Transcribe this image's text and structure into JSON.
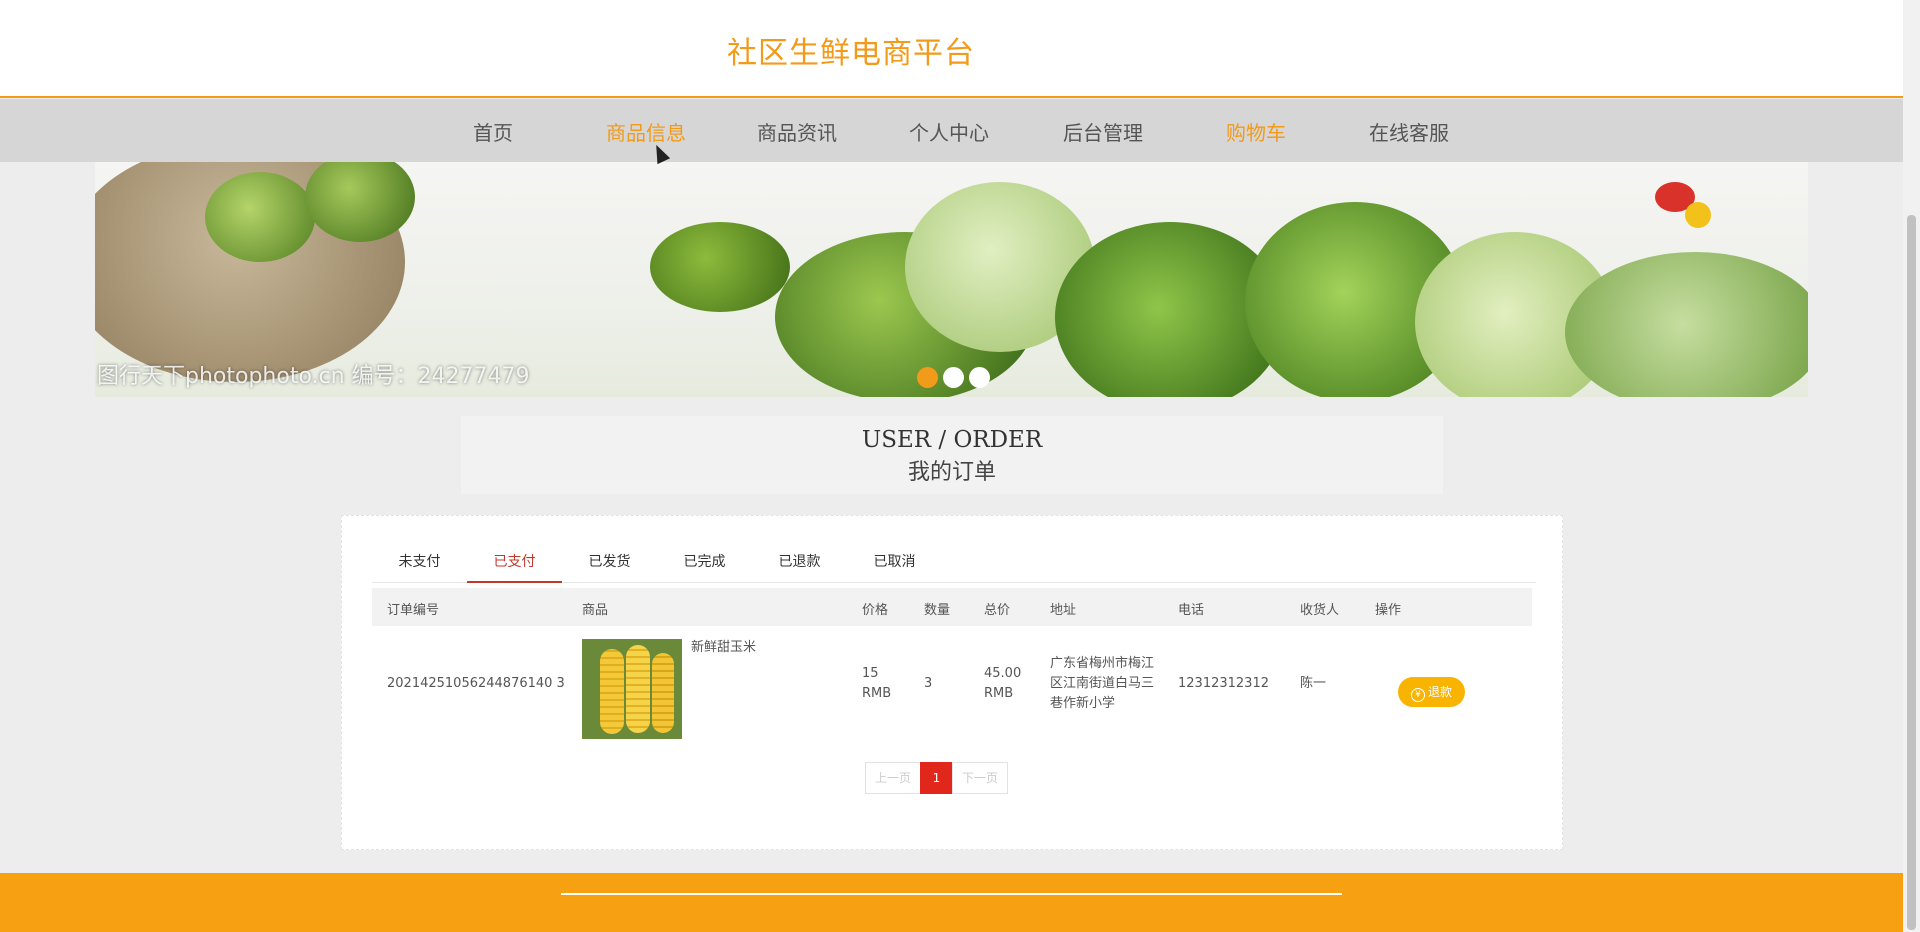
{
  "header": {
    "site_title": "社区生鲜电商平台"
  },
  "nav": {
    "items": [
      {
        "label": "首页"
      },
      {
        "label": "商品信息"
      },
      {
        "label": "商品资讯"
      },
      {
        "label": "个人中心"
      },
      {
        "label": "后台管理"
      },
      {
        "label": "购物车"
      },
      {
        "label": "在线客服"
      }
    ]
  },
  "banner": {
    "watermark": "图行天下photophoto.cn  编号：24277479",
    "dots_count": 3,
    "active_dot": 1
  },
  "section": {
    "title_en": "USER / ORDER",
    "title_cn": "我的订单"
  },
  "tabs": [
    {
      "label": "未支付"
    },
    {
      "label": "已支付"
    },
    {
      "label": "已发货"
    },
    {
      "label": "已完成"
    },
    {
      "label": "已退款"
    },
    {
      "label": "已取消"
    }
  ],
  "active_tab": "已支付",
  "table": {
    "headers": [
      "订单编号",
      "商品",
      "价格",
      "数量",
      "总价",
      "地址",
      "电话",
      "收货人",
      "操作"
    ],
    "rows": [
      {
        "order_no": "20214251056244876140 3",
        "product_name": "新鲜甜玉米",
        "price": "15\nRMB",
        "quantity": "3",
        "total": "45.00\nRMB",
        "address": "广东省梅州市梅江区江南街道白马三巷作新小学",
        "phone": "12312312312",
        "receiver": "陈一",
        "action": "退款"
      }
    ]
  },
  "pager": {
    "prev": "上一页",
    "current": "1",
    "next": "下一页"
  },
  "colors": {
    "accent": "#f29a1a",
    "danger": "#e1261c",
    "button": "#f8b400"
  }
}
